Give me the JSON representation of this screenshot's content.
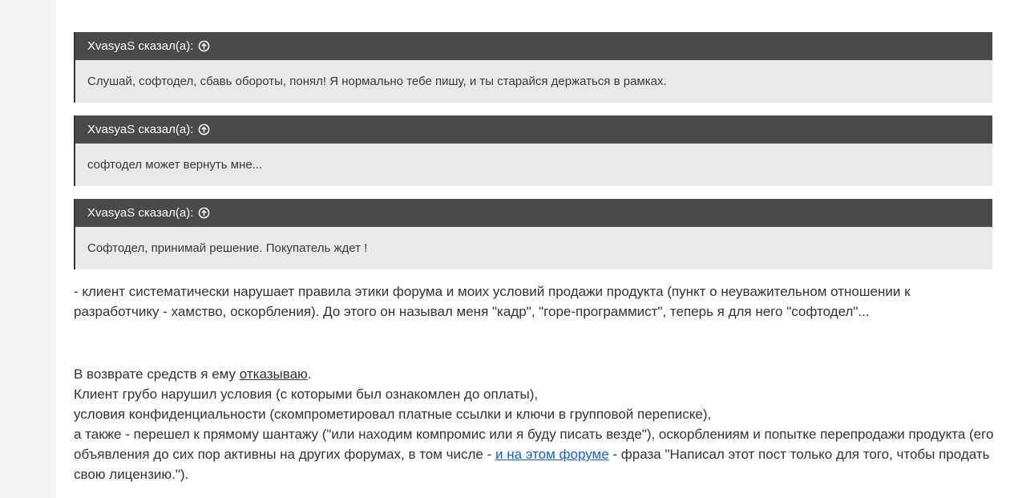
{
  "quotes": [
    {
      "author": "XvasyaS сказал(а):",
      "text": "Слушай, софтодел, сбавь обороты, понял! Я нормально тебе пишу, и ты старайся держаться в рамках."
    },
    {
      "author": "XvasyaS сказал(а):",
      "text": "софтодел может вернуть мне..."
    },
    {
      "author": "XvasyaS сказал(а):",
      "text": "Софтодел, принимай решение. Покупатель ждет !"
    }
  ],
  "paragraph1": "- клиент систематически нарушает правила этики форума и моих условий продажи продукта (пункт о неуважительном отношении к разработчику - хамство, оскорбления). До этого он называл меня \"кадр\", \"горе-программист\", теперь я для него \"софтодел\"...",
  "paragraph2": {
    "line1_before": "В возврате средств я ему ",
    "line1_link": "отказываю",
    "line1_after": ".",
    "line2": "Клиент грубо нарушил условия (с которыми был ознакомлен до оплаты),",
    "line3": "условия конфиденциальности (скомпрометировал платные ссылки и ключи в групповой переписке),",
    "line4_before": "а также - перешел к прямому шантажу (\"или находим компромис или я буду писать везде\"), оскорблениям и попытке перепродажи продукта (его объявления до сих пор активны на других форумах, в том числе - ",
    "line4_link": "и на этом форуме",
    "line4_after": " - фраза \"Написал этот пост только для того, чтобы продать свою лицензию.\")."
  },
  "colors": {
    "quote_header": "#4a4a4a",
    "quote_body": "#e9e9e9",
    "link": "#1a5fd6"
  }
}
